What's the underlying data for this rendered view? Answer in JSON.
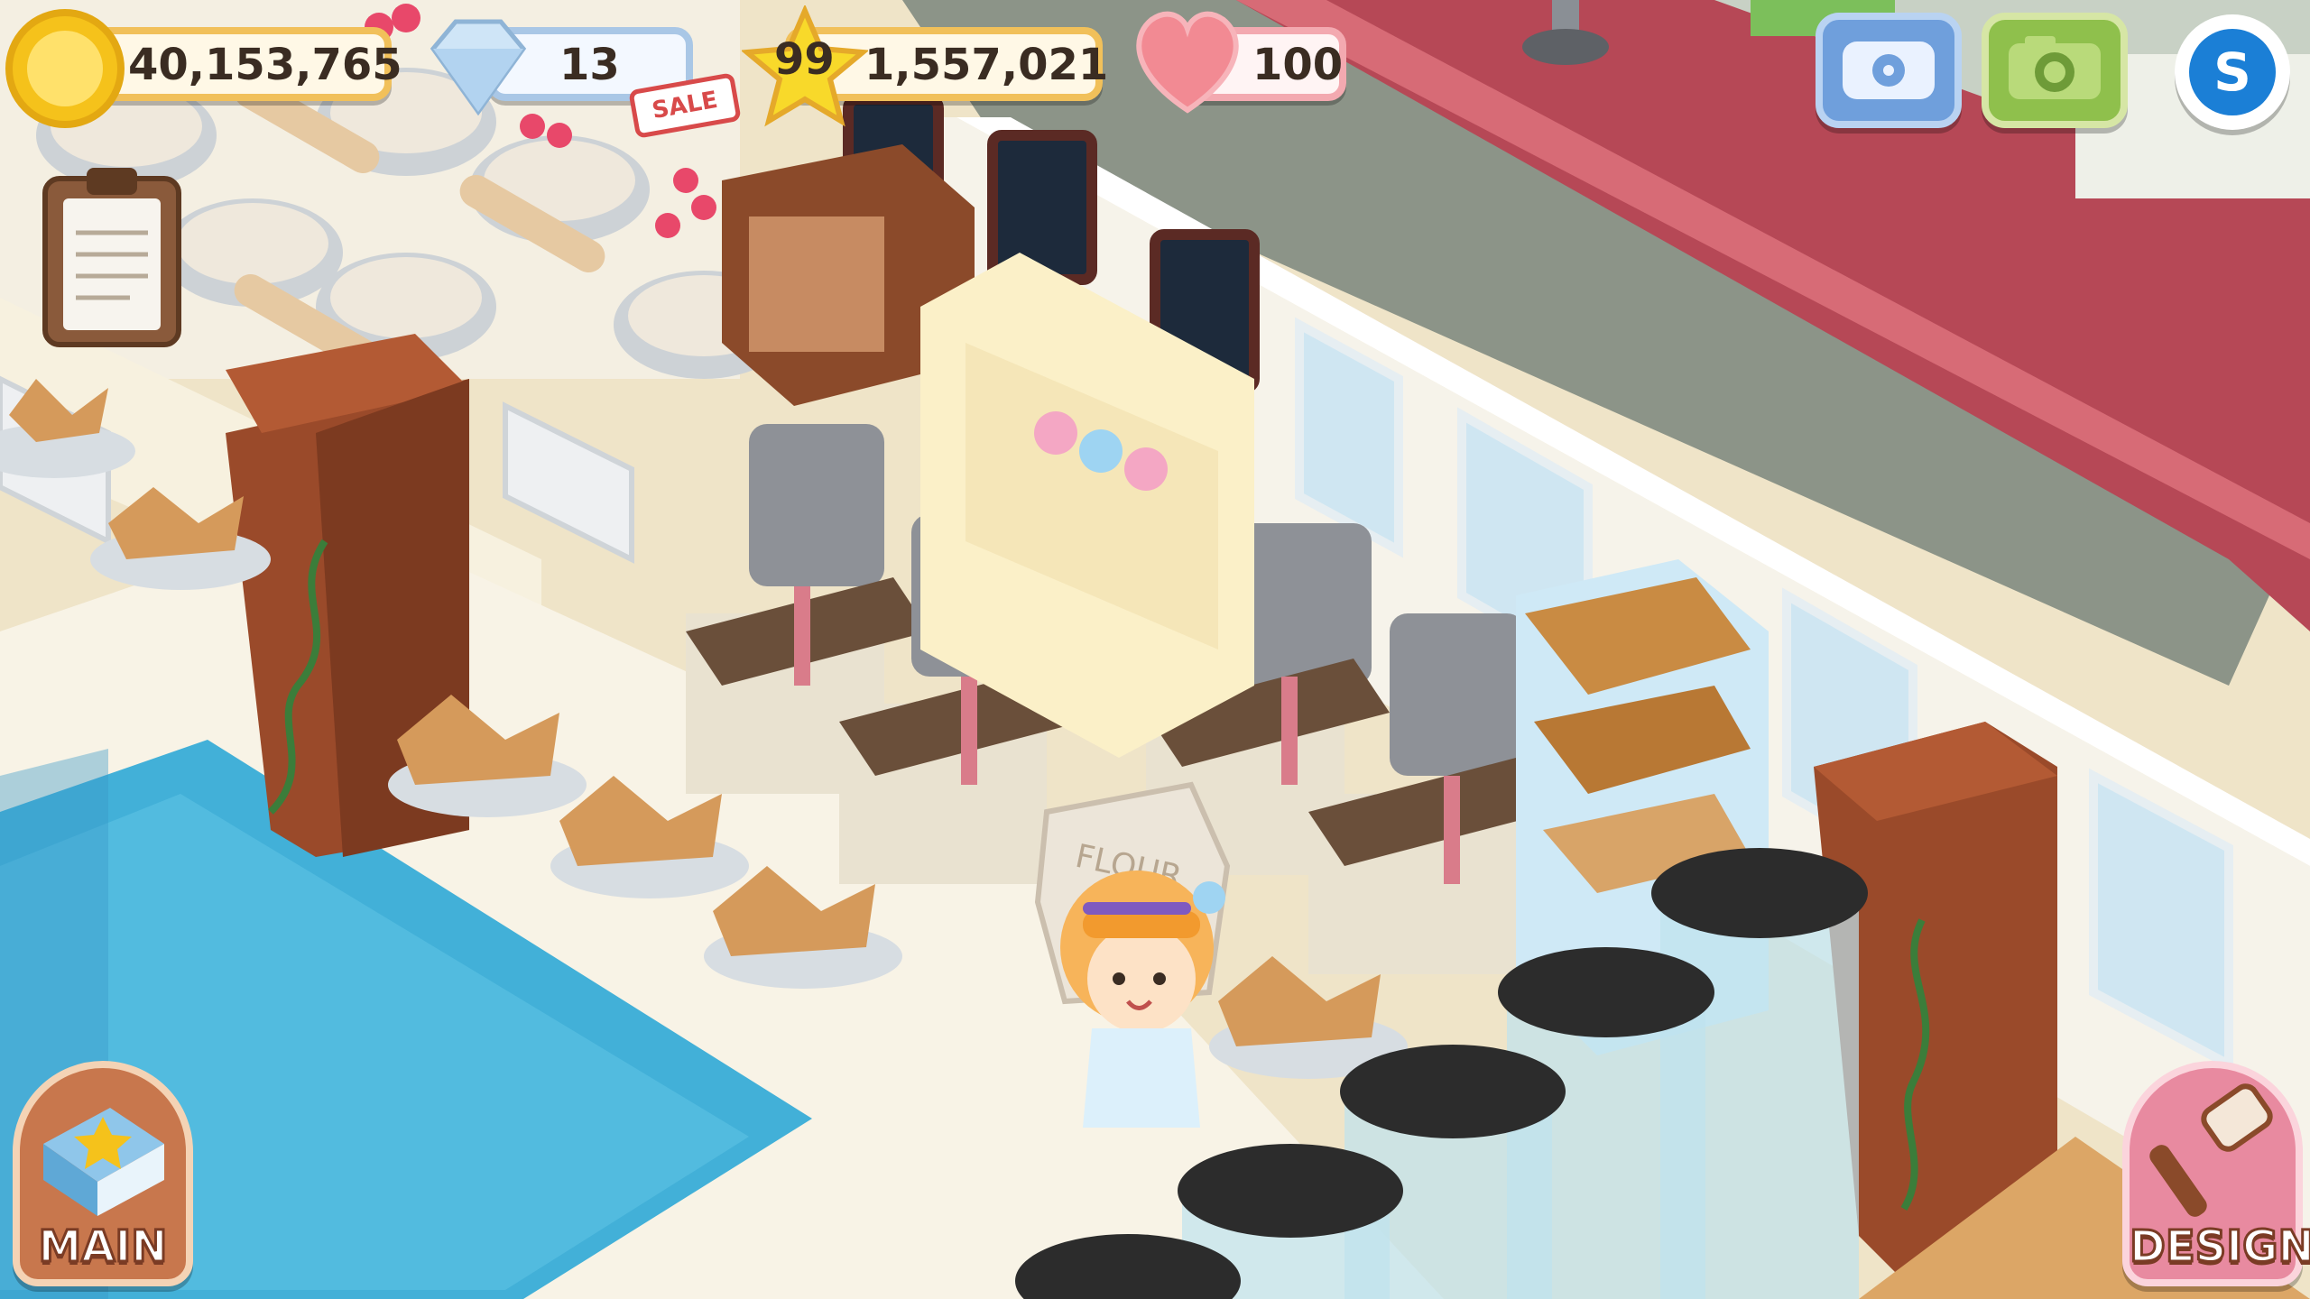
{
  "hud": {
    "coins": "40,153,765",
    "gems": "13",
    "gems_badge": "SALE",
    "level": "99",
    "experience": "1,557,021",
    "hearts": "100"
  },
  "scene": {
    "flour_sack_label": "FLOUR"
  },
  "buttons": {
    "main_label": "MAIN",
    "design_label": "DESIGN"
  },
  "colors": {
    "coin": "#f5c21b",
    "gem": "#b9d9f4",
    "star": "#f8d92a",
    "heart": "#f28a93",
    "phone_button": "#6f9fdc",
    "camera_button": "#8fc04c",
    "social_button": "#1b7fd6",
    "main_button": "#c8774d",
    "design_button": "#e88aa0"
  }
}
